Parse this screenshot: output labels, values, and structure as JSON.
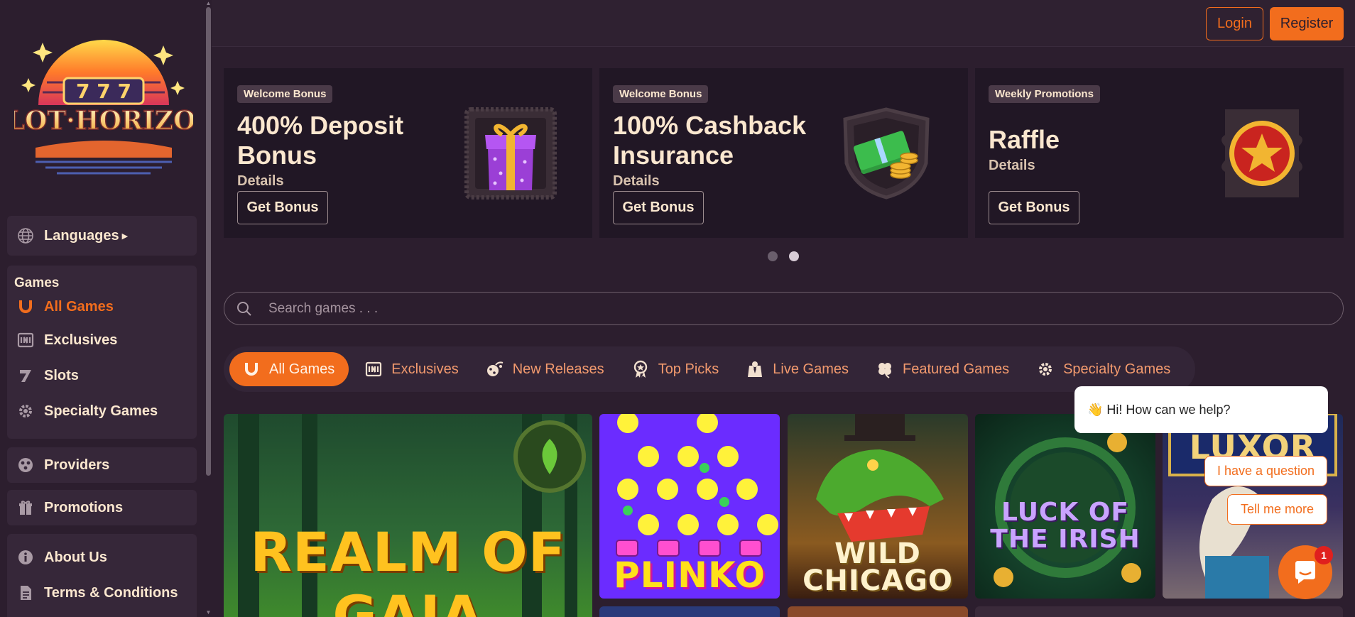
{
  "brand": {
    "logo_text": "SLOT·HORIZON",
    "logo_digits": "777"
  },
  "header": {
    "login_label": "Login",
    "register_label": "Register"
  },
  "sidebar": {
    "languages_label": "Languages",
    "games_heading": "Games",
    "games_items": [
      {
        "label": "All Games",
        "icon": "horseshoe-icon",
        "active": true
      },
      {
        "label": "Exclusives",
        "icon": "exclusive-icon"
      },
      {
        "label": "Slots",
        "icon": "seven-icon"
      },
      {
        "label": "Specialty Games",
        "icon": "gear-icon"
      }
    ],
    "providers_label": "Providers",
    "promotions_label": "Promotions",
    "about_label": "About Us",
    "terms_label": "Terms & Conditions"
  },
  "promos": [
    {
      "badge": "Welcome Bonus",
      "title": "400% Deposit Bonus",
      "details": "Details",
      "button": "Get Bonus",
      "art": "gift-box-icon"
    },
    {
      "badge": "Welcome Bonus",
      "title": "100% Cashback Insurance",
      "details": "Details",
      "button": "Get Bonus",
      "art": "money-stack-icon"
    },
    {
      "badge": "Weekly Promotions",
      "title": "Raffle",
      "details": "Details",
      "button": "Get Bonus",
      "art": "star-medal-icon"
    }
  ],
  "carousel": {
    "active_index": 2,
    "count": 2
  },
  "search": {
    "placeholder": "Search games . . ."
  },
  "tabs": [
    {
      "label": "All Games",
      "icon": "horseshoe-icon",
      "active": true
    },
    {
      "label": "Exclusives",
      "icon": "exclusive-icon"
    },
    {
      "label": "New Releases",
      "icon": "new-releases-icon"
    },
    {
      "label": "Top Picks",
      "icon": "award-icon"
    },
    {
      "label": "Live Games",
      "icon": "live-dealer-icon"
    },
    {
      "label": "Featured Games",
      "icon": "clover-icon"
    },
    {
      "label": "Specialty Games",
      "icon": "gear-icon"
    }
  ],
  "games": [
    {
      "title": "REALM OF GAIA"
    },
    {
      "title": "PLINKO"
    },
    {
      "title": "WILD CHICAGO"
    },
    {
      "title": "LUCK OF THE IRISH"
    },
    {
      "title": "LUXOR"
    }
  ],
  "chat": {
    "greeting": "👋 Hi! How can we help?",
    "options": [
      "I have a question",
      "Tell me more"
    ],
    "unread_count": "1"
  },
  "colors": {
    "accent": "#f26d1d",
    "background": "#2c1e2e",
    "card": "#362739",
    "text": "#fbe7cf"
  }
}
